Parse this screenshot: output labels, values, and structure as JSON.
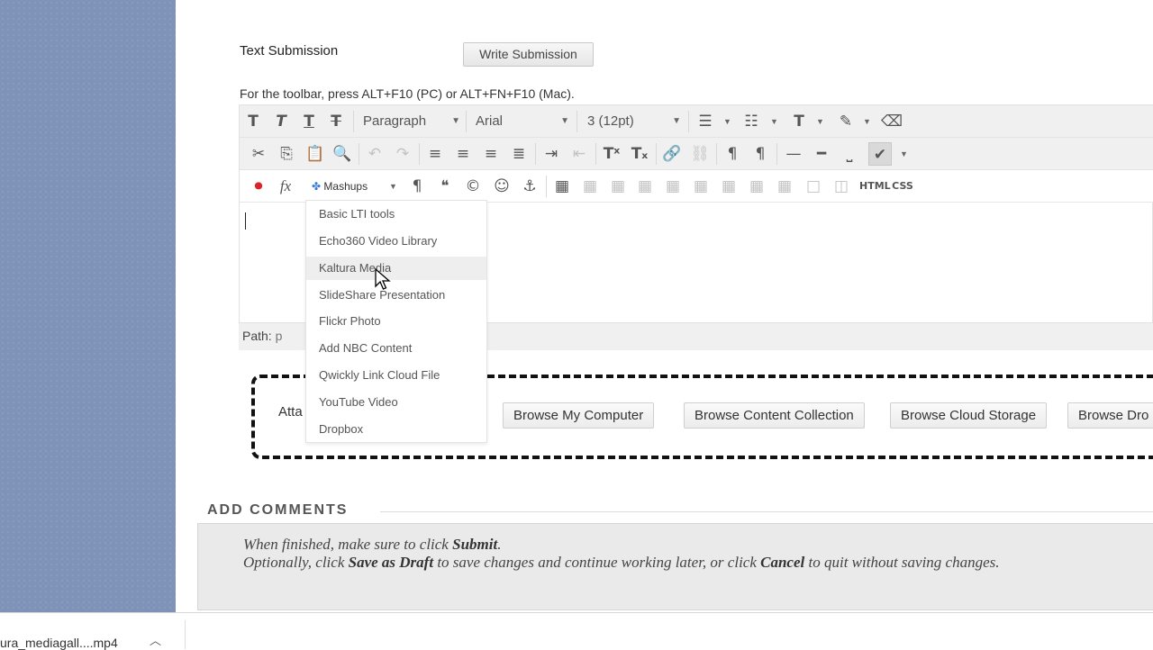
{
  "submission": {
    "text_label": "Text Submission",
    "write_button": "Write Submission",
    "toolbar_hint": "For the toolbar, press ALT+F10 (PC) or ALT+FN+F10 (Mac)."
  },
  "editor": {
    "format_select": "Paragraph",
    "font_select": "Arial",
    "size_select": "3 (12pt)",
    "mashups_label": "Mashups",
    "html_label": "HTML",
    "css_label": "CSS",
    "path_label": "Path:",
    "path_value": "p"
  },
  "mashups_menu": {
    "items": [
      "Basic LTI tools",
      "Echo360 Video Library",
      "Kaltura Media",
      "SlideShare Presentation",
      "Flickr Photo",
      "Add NBC Content",
      "Qwickly Link Cloud File",
      "YouTube Video",
      "Dropbox"
    ],
    "hovered": "Kaltura Media"
  },
  "attach": {
    "label": "Atta",
    "buttons": [
      "Browse My Computer",
      "Browse Content Collection",
      "Browse Cloud Storage",
      "Browse Dro"
    ]
  },
  "comments": {
    "heading": "ADD COMMENTS",
    "line1_a": "When finished, make sure to click ",
    "line1_b": "Submit",
    "line1_c": ".",
    "line2_a": "Optionally, click ",
    "line2_b": "Save as Draft",
    "line2_c": " to save changes and continue working later, or click ",
    "line2_d": "Cancel",
    "line2_e": " to quit without saving changes."
  },
  "download": {
    "filename": "ura_mediagall....mp4"
  },
  "colors": {
    "left_rail": "#7f93b8",
    "dashed_border": "#111111",
    "record_icon": "#d9252a"
  }
}
